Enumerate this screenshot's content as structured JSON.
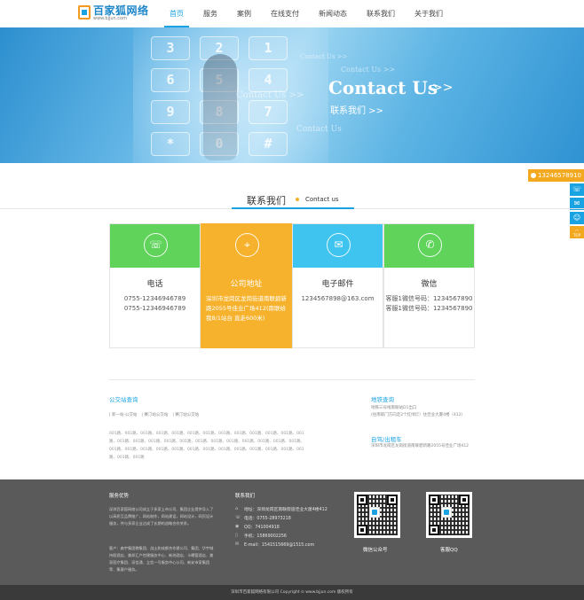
{
  "header": {
    "logo_name": "百家狐网络",
    "logo_url": "www.bjjun.com",
    "nav": [
      {
        "label": "首页",
        "active": true
      },
      {
        "label": "服务"
      },
      {
        "label": "案例"
      },
      {
        "label": "在线支付"
      },
      {
        "label": "新闻动态"
      },
      {
        "label": "联系我们"
      },
      {
        "label": "关于我们"
      }
    ]
  },
  "banner": {
    "keys": [
      "3",
      "2",
      "1",
      "6",
      "5",
      "4",
      "9",
      "8",
      "7",
      "*",
      "0",
      "#"
    ],
    "faded_1": "Contact Us >>",
    "faded_2": "Contact Us >>",
    "faded_3": "Contact Us >>",
    "faded_4": "Contact Us",
    "main_en": "Contact Us",
    "main_arrow": ">>",
    "main_cn": "联系我们 >>"
  },
  "section": {
    "title_cn": "联系我们",
    "title_en": "Contact us"
  },
  "side": {
    "phone": "13246578910",
    "top_label": "TOP"
  },
  "cards": [
    {
      "title": "电话",
      "lines": [
        "0755-12346946789",
        "0755-12346946789"
      ],
      "icon": "phone-icon",
      "color": "#5fd35a"
    },
    {
      "title": "公司地址",
      "address": "深圳市龙岗区龙岗街道南联碧新路2055号佳业广场412(南联给我8/1站台 直走600米)",
      "icon": "location-icon",
      "color": "#f6b22c"
    },
    {
      "title": "电子邮件",
      "lines": [
        "1234567898@163.com"
      ],
      "icon": "mail-icon",
      "color": "#3fc4f0"
    },
    {
      "title": "微信",
      "lines": [
        "客服1微信号码：1234567890",
        "客服1微信号码：1234567890"
      ],
      "icon": "wechat-icon",
      "color": "#5fd35a"
    }
  ],
  "links": {
    "left_title": "公交站查询",
    "tags": [
      "| 新一站·公交站",
      "| 赛汀站公交站",
      "| 赛汀站公交站"
    ],
    "grid": "001路、001路、001路、001路、001路、001路、001路、001路、001路、001路、001路、001路、001路、001路、001路、001路、001路、001路、001路、001路、001路、001路、001路、001路、001路、001路、001路、001路、001路、001路、001路、001路、001路、001路、001路、001路、001路、001路、001路、001路",
    "metro_title": "地铁查询",
    "metro_1": "地铁三号线南联站D1出口",
    "metro_2": "(往南取门方向走2个红绿灯）往佳业大厦4楼（412）",
    "drive_title": "自驾/出租车",
    "drive_1": "深圳市龙岗区龙岗街道南联碧新路2055号佳业广场412"
  },
  "footer": {
    "adv_title": "服务优势",
    "adv_p1": "深圳百家狐网络公司成立于多家上市公司、集团企业提供导入了以高质互品牌推广，网站制作，网站建设，网站设计，网页设计服务，并与多家企业达成了长期的战略合作关系。",
    "adv_p2": "客户：森宇集团教集团、战土和成都合作建公司、集团、华宇城持股酒店、美邦汇产控建服务中心、新纬酒店、卡曦管酒店、美家医疗集团、深信通、立信一号服务中心公司、新安市家集团等、集客户服务。",
    "contact_title": "联系我们",
    "contact_rows": [
      {
        "icon": "home-icon",
        "glyph": "⌂",
        "text": "地址：深圳龙岗区南联街道佳业大厦4楼412"
      },
      {
        "icon": "phone-icon",
        "glyph": "☏",
        "text": "电话：0755-28973218"
      },
      {
        "icon": "qq-icon",
        "glyph": "◉",
        "text": "QQ：741004918"
      },
      {
        "icon": "mobile-icon",
        "glyph": "▯",
        "text": "手机：15869002256"
      },
      {
        "icon": "mail-icon",
        "glyph": "✉",
        "text": "E-mail：1541515669@1515.com"
      }
    ],
    "qr1_label": "微信公众号",
    "qr2_label": "客服QQ",
    "copyright": "深圳市百家狐网络有限公司 Copyright ⊙  www.bjjun.com 版权所有"
  }
}
